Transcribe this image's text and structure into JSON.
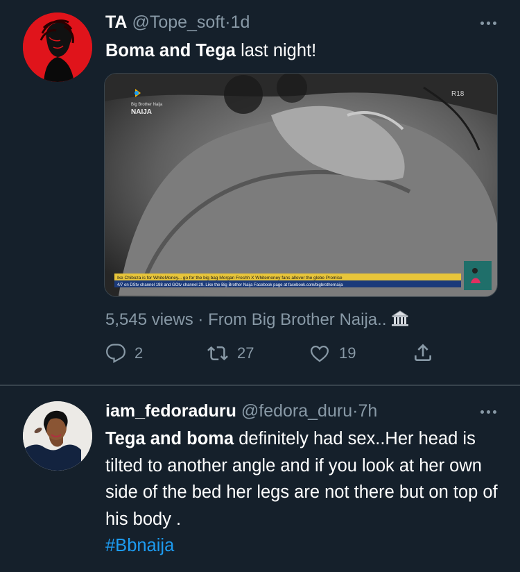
{
  "tweet1": {
    "display_name": "TA",
    "handle": "@Tope_soft",
    "separator": "·",
    "time": "1d",
    "text_bold": "Boma and Tega",
    "text_rest": " last night!",
    "media_caption_top": "Big Brother Naija",
    "media_watermark": "NAIJA",
    "media_badge": "R18",
    "media_ticker1": "Ike Chiboza is for WhiteMoney... go for the big bag  Morgan Freshh X Whitemoney fans allover the globe  Promise",
    "media_ticker2": "4/7 on DStv channel 198 and GOtv channel 29.  Like the Big Brother Naija Facebook page at facebook.com/bigbrothernaija",
    "views_count": "5,545 views",
    "views_sep": " · ",
    "views_source": "From Big Brother Naija..",
    "replies": "2",
    "retweets": "27",
    "likes": "19"
  },
  "tweet2": {
    "display_name": "iam_fedoraduru",
    "handle": "@fedora_duru",
    "separator": "·",
    "time": "7h",
    "text_bold": "Tega and boma",
    "text_rest": " definitely had sex..Her head is tilted to another angle and if you look at her own side of the bed her legs are not there but on top of his body .",
    "hashtag": "#Bbnaija"
  },
  "colors": {
    "background": "#15202b",
    "secondary_text": "#8899a6",
    "link": "#1d9bf0",
    "divider": "#38444d",
    "avatar_red": "#e0141b"
  },
  "icons": [
    "more-icon",
    "reply-icon",
    "retweet-icon",
    "like-icon",
    "share-icon",
    "museum-emoji"
  ]
}
